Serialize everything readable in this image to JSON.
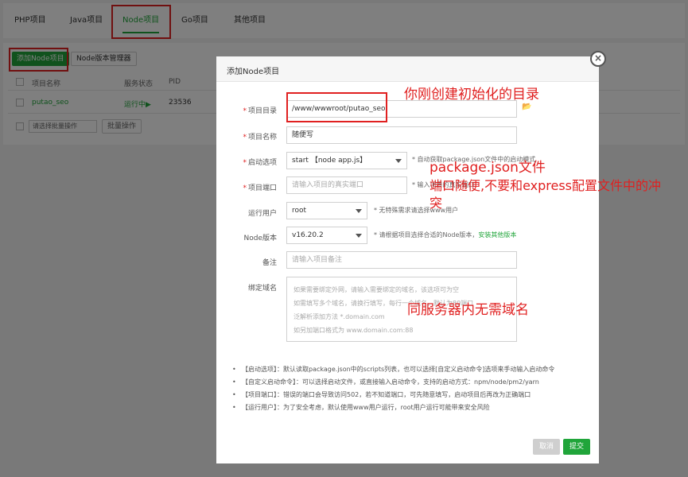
{
  "tabs": [
    "PHP项目",
    "Java项目",
    "Node项目",
    "Go项目",
    "其他项目"
  ],
  "toolbar": {
    "add_label": "添加Node项目",
    "version_mgr_label": "Node版本管理器"
  },
  "table": {
    "headers": [
      "项目名称",
      "服务状态",
      "PID"
    ],
    "row": {
      "name": "putao_seo",
      "status": "运行中▶",
      "pid": "23536"
    }
  },
  "batch": {
    "select_placeholder": "请选择批量操作",
    "button_label": "批量操作"
  },
  "modal": {
    "title": "添加Node项目",
    "close": "×",
    "fields": {
      "dir": {
        "label": "项目目录",
        "value": "/www/wwwroot/putao_seo"
      },
      "name": {
        "label": "项目名称",
        "value": "随便写"
      },
      "start": {
        "label": "启动选项",
        "value": "start 【node app.js】",
        "hint": "* 自动获取package.json文件中的启动模式"
      },
      "port": {
        "label": "项目端口",
        "placeholder": "请输入项目的真实端口",
        "hint": "* 输入项目的真实端口"
      },
      "user": {
        "label": "运行用户",
        "value": "root",
        "hint": "* 无特殊需求请选择www用户"
      },
      "version": {
        "label": "Node版本",
        "value": "v16.20.2",
        "hint": "* 请根据项目选择合适的Node版本，",
        "hint_link": "安装其他版本"
      },
      "remark": {
        "label": "备注",
        "placeholder": "请输入项目备注"
      },
      "domain": {
        "label": "绑定域名",
        "placeholder_lines": [
          "如果需要绑定外网，请输入需要绑定的域名，该选项可为空",
          "如需填写多个域名，请换行填写，每行一个域名，默认为80端口",
          "泛解析添加方法 *.domain.com",
          "如另加端口格式为 www.domain.com:88"
        ]
      }
    },
    "notes": [
      "【启动选项】：默认读取package.json中的scripts列表，也可以选择[自定义启动命令]选项来手动输入启动命令",
      "【自定义启动命令】：可以选择启动文件，或直接输入启动命令，支持的启动方式：npm/node/pm2/yarn",
      "【项目端口】：错误的端口会导致访问502，若不知道端口，可先随意填写，启动项目后再改为正确端口",
      "【运行用户】：为了安全考虑，默认使用www用户运行，root用户运行可能带来安全风险"
    ],
    "cancel_label": "取消",
    "submit_label": "提交"
  },
  "annotations": {
    "dir_note": "你刚创建初始化的目录",
    "pkg_note": "package.json文件",
    "port_note_1": "端口随便,不要和express配置文件中的冲",
    "port_note_2": "突",
    "domain_note": "同服务器内无需域名"
  },
  "colors": {
    "accent": "#20a53a",
    "annotation": "#e02020"
  }
}
